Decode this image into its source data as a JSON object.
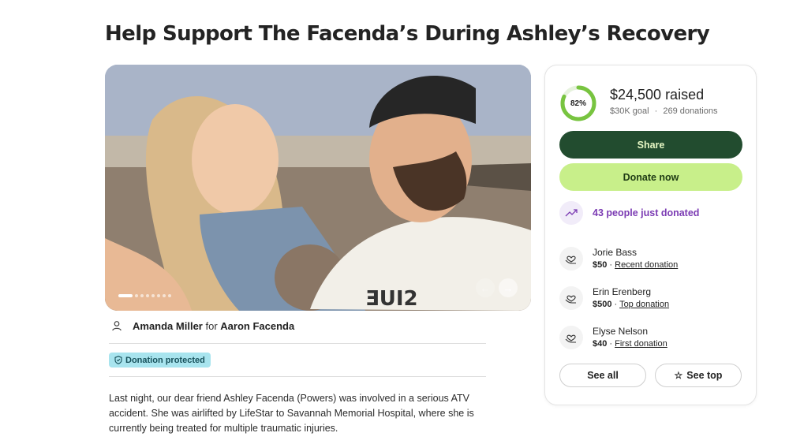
{
  "campaign": {
    "title": "Help Support The Facenda’s During Ashley’s Recovery"
  },
  "organizer": {
    "name": "Amanda Miller",
    "connector": "for",
    "beneficiary": "Aaron Facenda"
  },
  "badge": {
    "label": "Donation protected"
  },
  "story": {
    "text": "Last night, our dear friend Ashley Facenda (Powers) was involved in a serious ATV accident. She was airlifted by LifeStar to Savannah Memorial Hospital, where she is currently being treated for multiple traumatic injuries."
  },
  "carousel": {
    "slide_count": 8,
    "active_index": 0
  },
  "progress": {
    "percent_label": "82%",
    "percent_value": 82,
    "raised": "$24,500 raised",
    "goal": "$30K goal",
    "separator": "·",
    "donations": "269 donations"
  },
  "actions": {
    "share": "Share",
    "donate": "Donate now",
    "see_all": "See all",
    "see_top": "See top"
  },
  "activity": {
    "recent_text": "43 people just donated"
  },
  "donors": [
    {
      "name": "Jorie Bass",
      "amount": "$50",
      "sep": " · ",
      "tag": "Recent donation"
    },
    {
      "name": "Erin Erenberg",
      "amount": "$500",
      "sep": " · ",
      "tag": "Top donation"
    },
    {
      "name": "Elyse Nelson",
      "amount": "$40",
      "sep": " · ",
      "tag": "First donation"
    }
  ],
  "colors": {
    "share_bg": "#224c2f",
    "donate_bg": "#c8ef8a",
    "progress": "#78c440",
    "trend_text": "#7b3bb3",
    "badge_bg": "#a8e4ee"
  },
  "icons": {
    "organizer": "person-icon",
    "badge": "shield-icon",
    "trend": "trending-up-icon",
    "donor": "heart-hand-icon",
    "see_top": "star-icon",
    "prev": "arrow-left-icon",
    "next": "arrow-right-icon"
  }
}
